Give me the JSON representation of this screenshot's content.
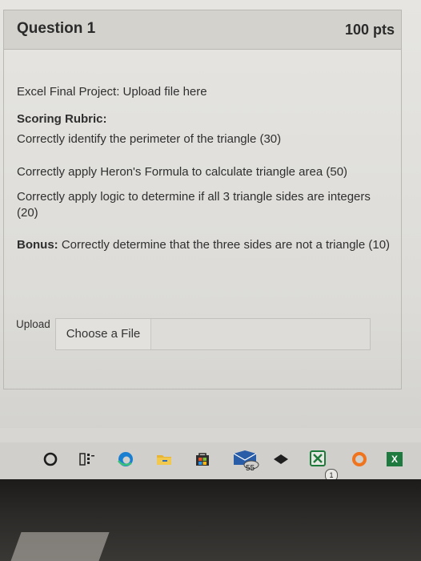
{
  "question": {
    "title": "Question 1",
    "points": "100 pts",
    "prompt": "Excel Final Project: Upload file here",
    "rubric_heading": "Scoring Rubric:",
    "rubric_items": [
      "Correctly identify the perimeter of the triangle (30)",
      "Correctly apply Heron's Formula to calculate triangle area (50)",
      "Correctly apply logic to determine if all 3 triangle sides are integers (20)"
    ],
    "bonus_label": "Bonus:",
    "bonus_text": " Correctly determine that the three sides are not a triangle (10)"
  },
  "upload": {
    "label": "Upload",
    "button_label": "Choose a File"
  },
  "taskbar": {
    "icons": [
      "search-circle-icon",
      "task-view-icon",
      "edge-icon",
      "file-explorer-icon",
      "store-icon",
      "mail-icon",
      "network-icon",
      "xbox-icon",
      "origin-icon",
      "excel-icon"
    ],
    "badge_55": "55",
    "badge_1": "1",
    "excel_letter": "X"
  },
  "colors": {
    "edge_blue": "#1b7fd1",
    "origin_orange": "#f0731e",
    "excel_green": "#1f7a3f",
    "store_green": "#3a7d2e"
  }
}
